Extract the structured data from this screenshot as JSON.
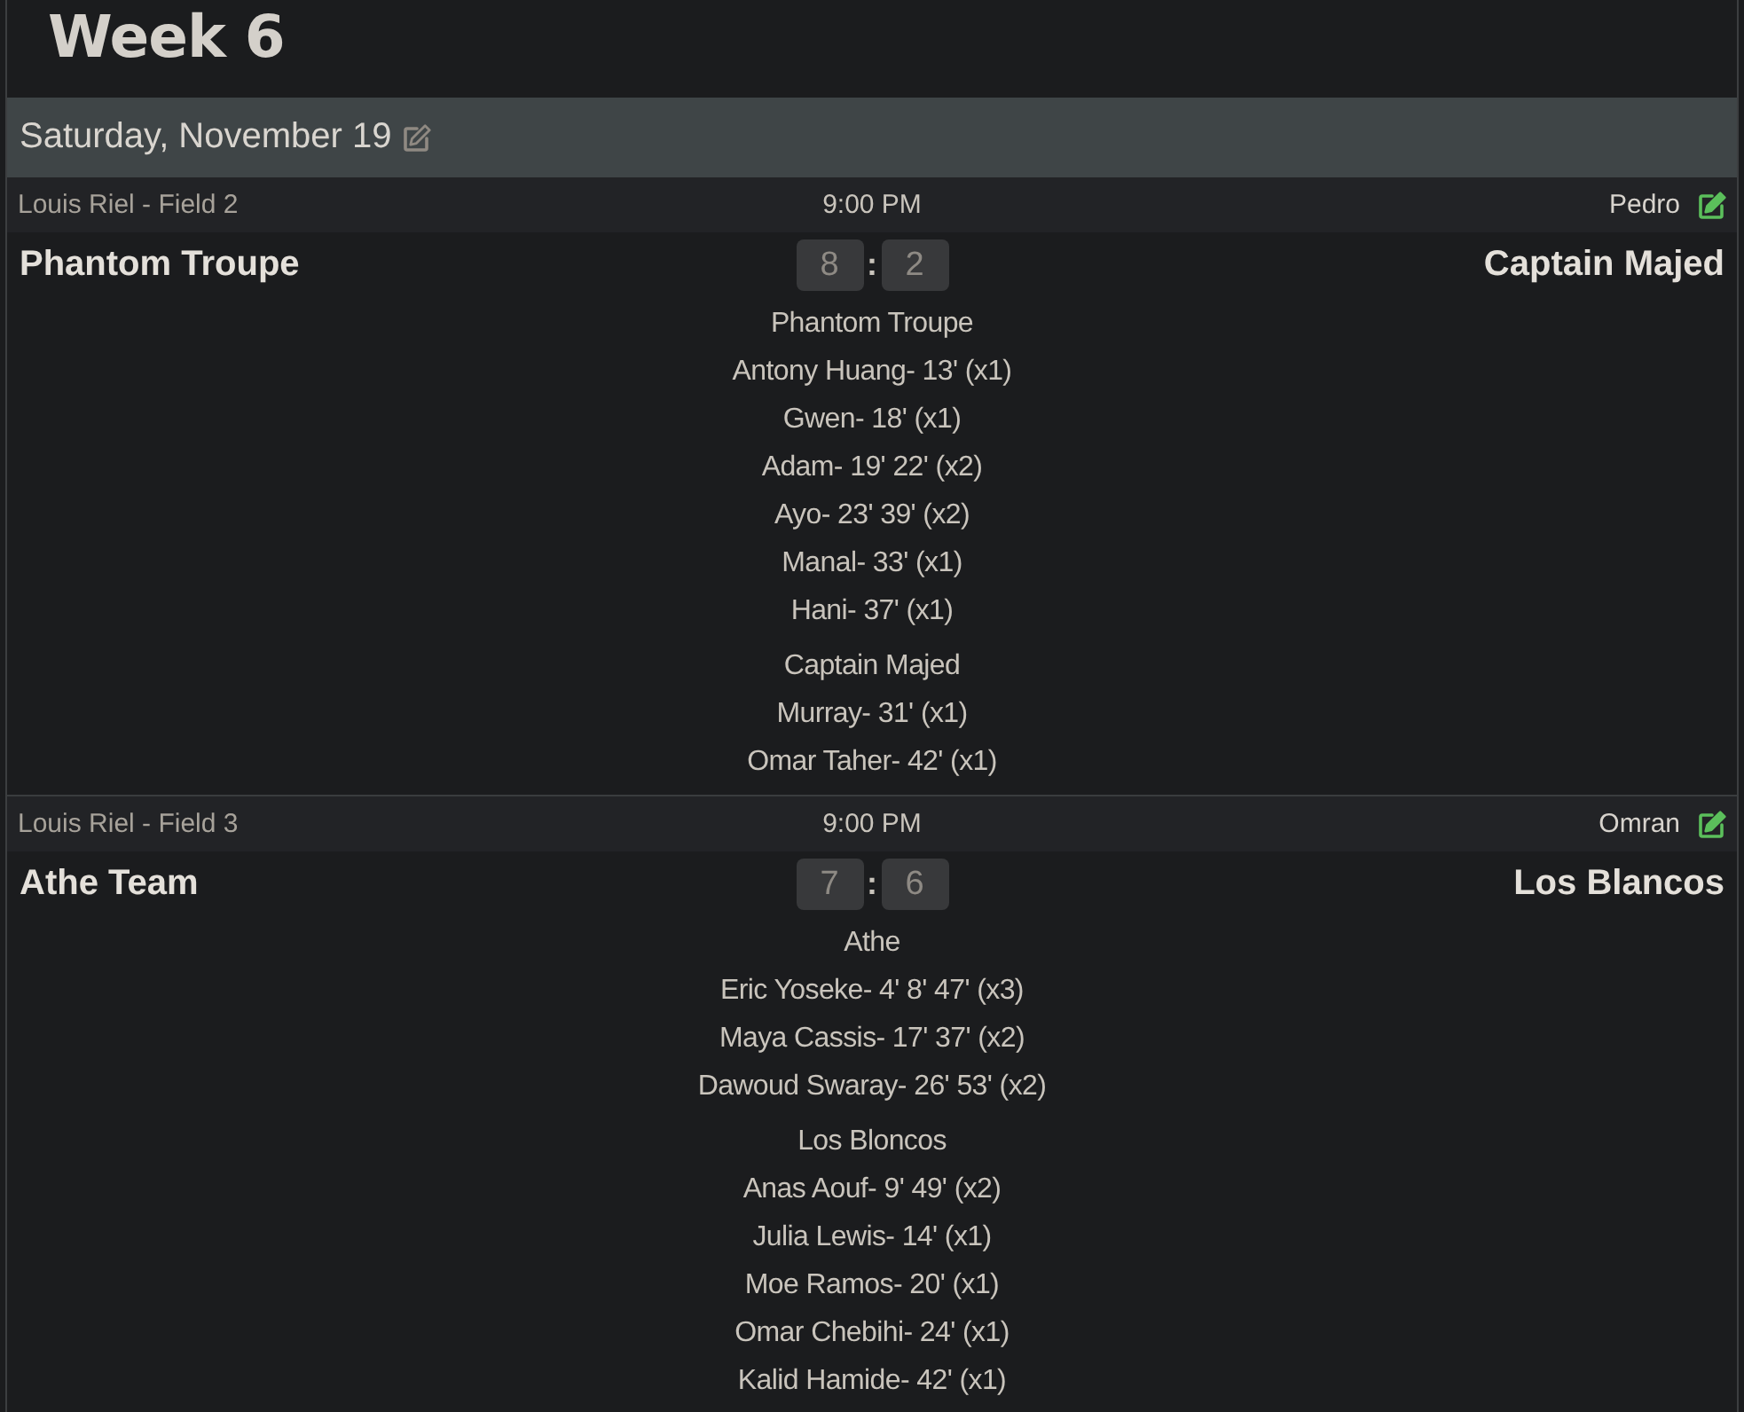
{
  "title": "Week 6",
  "day": {
    "date": "Saturday, November 19"
  },
  "games": [
    {
      "location": "Louis Riel - Field 2",
      "time": "9:00 PM",
      "referee": "Pedro",
      "home_team": "Phantom Troupe",
      "away_team": "Captain Majed",
      "score": {
        "home": "8",
        "separator": ":",
        "away": "2"
      },
      "scorer_groups": [
        {
          "team": "Phantom Troupe",
          "scorers": [
            "Antony Huang- 13' (x1)",
            "Gwen- 18' (x1)",
            "Adam- 19' 22' (x2)",
            "Ayo- 23' 39' (x2)",
            "Manal- 33' (x1)",
            "Hani- 37' (x1)"
          ]
        },
        {
          "team": "Captain Majed",
          "scorers": [
            "Murray- 31' (x1)",
            "Omar Taher- 42' (x1)"
          ]
        }
      ]
    },
    {
      "location": "Louis Riel - Field 3",
      "time": "9:00 PM",
      "referee": "Omran",
      "home_team": "Athe Team",
      "away_team": "Los Blancos",
      "score": {
        "home": "7",
        "separator": ":",
        "away": "6"
      },
      "scorer_groups": [
        {
          "team": "Athe",
          "scorers": [
            "Eric Yoseke- 4' 8' 47' (x3)",
            "Maya Cassis- 17' 37' (x2)",
            "Dawoud Swaray- 26' 53' (x2)"
          ]
        },
        {
          "team": "Los Bloncos",
          "scorers": [
            "Anas Aouf- 9' 49' (x2)",
            "Julia Lewis- 14' (x1)",
            "Moe Ramos- 20' (x1)",
            "Omar Chebihi- 24' (x1)",
            "Kalid Hamide- 42' (x1)"
          ]
        }
      ]
    }
  ]
}
